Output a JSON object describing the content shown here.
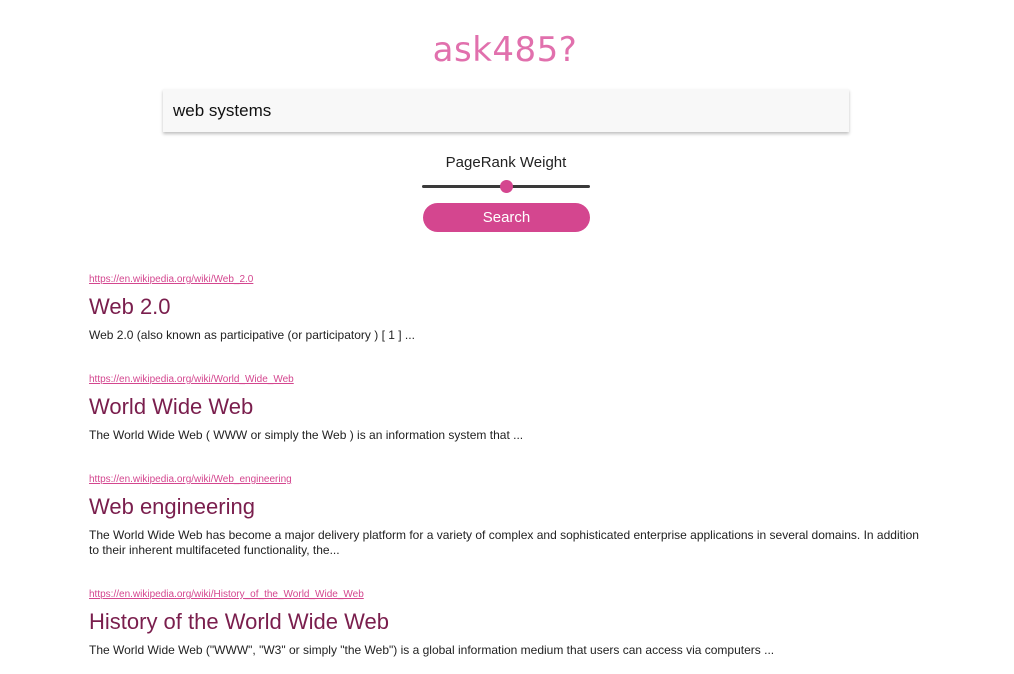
{
  "logo": "ask485?",
  "search": {
    "value": "web systems",
    "placeholder": ""
  },
  "slider": {
    "label": "PageRank Weight",
    "value": 0.5
  },
  "search_button_label": "Search",
  "colors": {
    "accent": "#d4468f",
    "logo": "#e170ad",
    "title": "#7a1e4d"
  },
  "results": [
    {
      "url": "https://en.wikipedia.org/wiki/Web_2.0",
      "title": "Web 2.0",
      "snippet": "Web 2.0 (also known as participative (or participatory ) [ 1 ] ..."
    },
    {
      "url": "https://en.wikipedia.org/wiki/World_Wide_Web",
      "title": "World Wide Web",
      "snippet": "The World Wide Web ( WWW or simply the Web ) is an information system that ..."
    },
    {
      "url": "https://en.wikipedia.org/wiki/Web_engineering",
      "title": "Web engineering",
      "snippet": "The World Wide Web has become a major delivery platform for a variety of complex and sophisticated enterprise applications in several domains. In addition to their inherent multifaceted functionality, the..."
    },
    {
      "url": "https://en.wikipedia.org/wiki/History_of_the_World_Wide_Web",
      "title": "History of the World Wide Web",
      "snippet": "The World Wide Web (\"WWW\", \"W3\" or simply \"the Web\") is a global information medium that users can access via computers ..."
    }
  ]
}
